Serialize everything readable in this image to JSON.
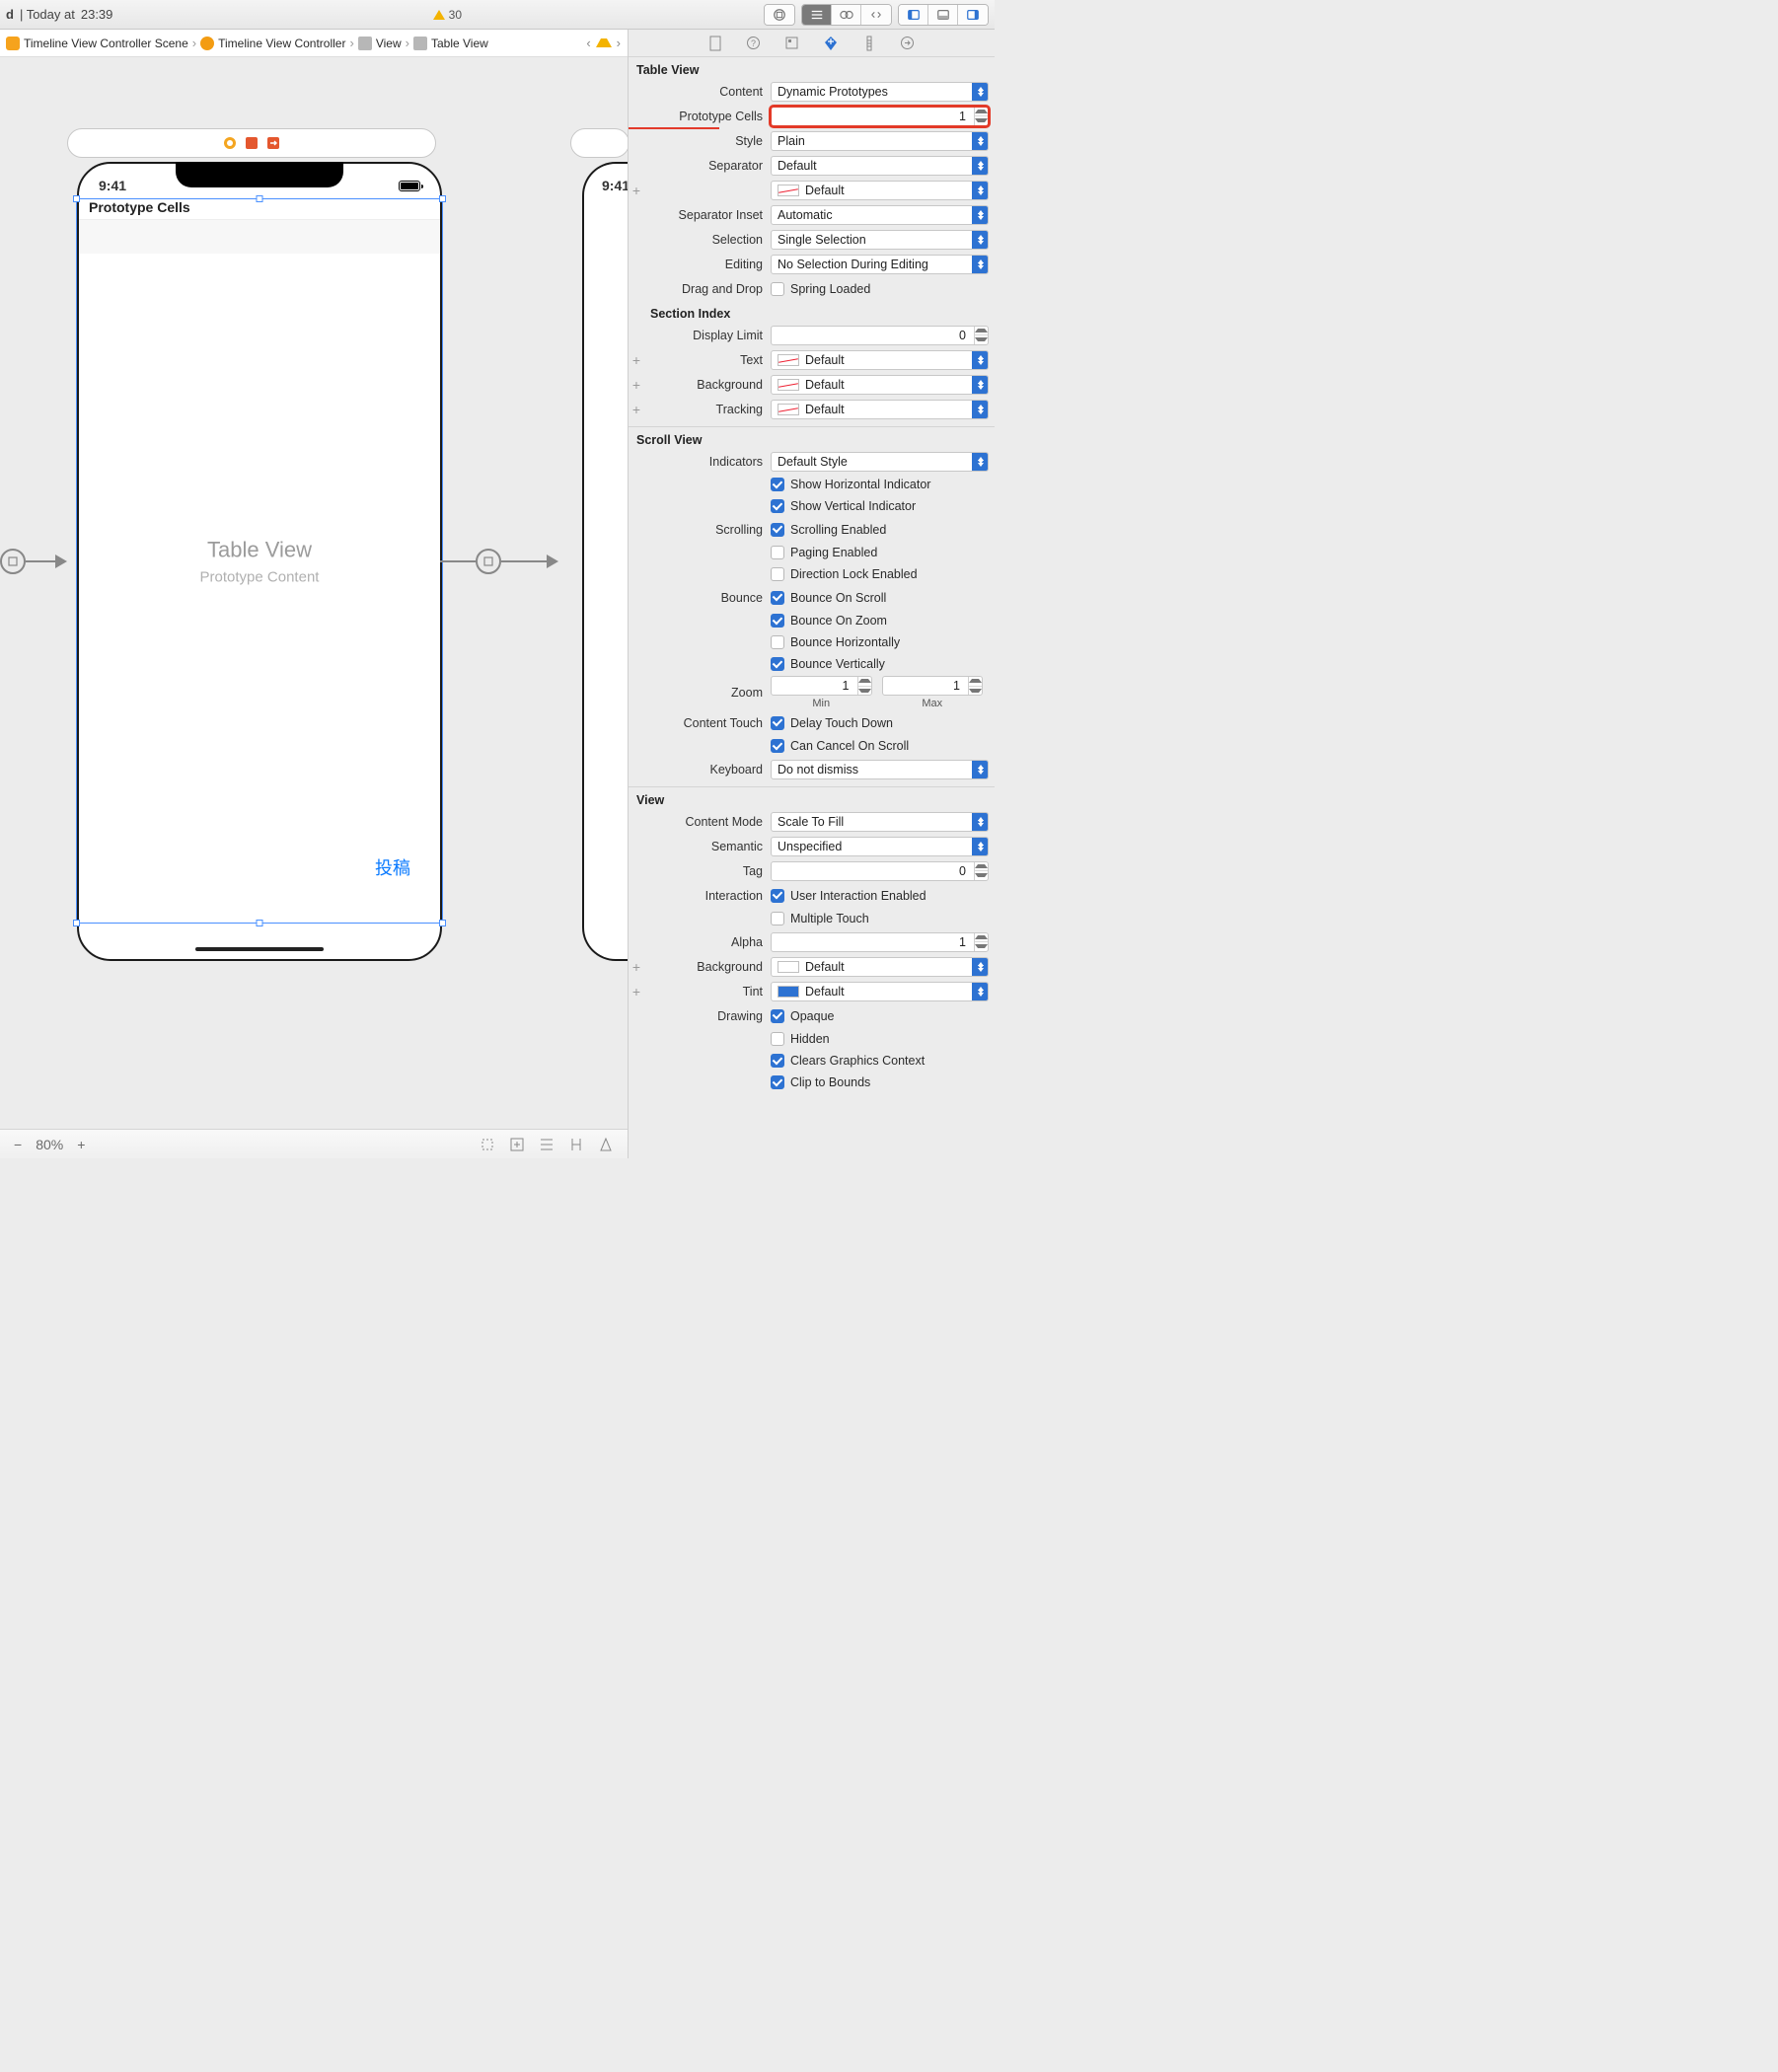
{
  "titlebar": {
    "prefix": "d",
    "time_prefix": "| Today at",
    "time": "23:39",
    "warning_count": "30"
  },
  "breadcrumb": {
    "items": [
      "Timeline View Controller Scene",
      "Timeline View Controller",
      "View",
      "Table View"
    ]
  },
  "canvas": {
    "capsule_icons": [
      "box",
      "cube",
      "export"
    ],
    "phone": {
      "time": "9:41",
      "cells_label": "Prototype Cells",
      "tableview_title": "Table View",
      "tableview_sub": "Prototype Content",
      "post_button": "投稿"
    },
    "phone2_time": "9:41",
    "zoom": "80%"
  },
  "inspector": {
    "tabs": [
      "file",
      "help",
      "identity",
      "attributes",
      "size",
      "connections"
    ],
    "table_view": {
      "title": "Table View",
      "content_label": "Content",
      "content": "Dynamic Prototypes",
      "prototype_cells_label": "Prototype Cells",
      "prototype_cells": "1",
      "style_label": "Style",
      "style": "Plain",
      "separator_label": "Separator",
      "separator": "Default",
      "separator_color": "Default",
      "separator_inset_label": "Separator Inset",
      "separator_inset": "Automatic",
      "selection_label": "Selection",
      "selection": "Single Selection",
      "editing_label": "Editing",
      "editing": "No Selection During Editing",
      "drag_drop_label": "Drag and Drop",
      "spring_loaded": "Spring Loaded",
      "section_index_title": "Section Index",
      "display_limit_label": "Display Limit",
      "display_limit": "0",
      "text_label": "Text",
      "text": "Default",
      "background_label": "Background",
      "background": "Default",
      "tracking_label": "Tracking",
      "tracking": "Default"
    },
    "scroll_view": {
      "title": "Scroll View",
      "indicators_label": "Indicators",
      "indicators": "Default Style",
      "show_h": "Show Horizontal Indicator",
      "show_v": "Show Vertical Indicator",
      "scrolling_label": "Scrolling",
      "scroll_enabled": "Scrolling Enabled",
      "paging": "Paging Enabled",
      "dirlock": "Direction Lock Enabled",
      "bounce_label": "Bounce",
      "bounce_scroll": "Bounce On Scroll",
      "bounce_zoom": "Bounce On Zoom",
      "bounce_h": "Bounce Horizontally",
      "bounce_v": "Bounce Vertically",
      "zoom_label": "Zoom",
      "zoom_min": "1",
      "zoom_max": "1",
      "min_label": "Min",
      "max_label": "Max",
      "content_touch_label": "Content Touch",
      "delay_touch": "Delay Touch Down",
      "cancel_scroll": "Can Cancel On Scroll",
      "keyboard_label": "Keyboard",
      "keyboard": "Do not dismiss"
    },
    "view": {
      "title": "View",
      "content_mode_label": "Content Mode",
      "content_mode": "Scale To Fill",
      "semantic_label": "Semantic",
      "semantic": "Unspecified",
      "tag_label": "Tag",
      "tag": "0",
      "interaction_label": "Interaction",
      "uie": "User Interaction Enabled",
      "multi": "Multiple Touch",
      "alpha_label": "Alpha",
      "alpha": "1",
      "background_label": "Background",
      "background": "Default",
      "tint_label": "Tint",
      "tint": "Default",
      "drawing_label": "Drawing",
      "opaque": "Opaque",
      "hidden": "Hidden",
      "clears_gc": "Clears Graphics Context",
      "clip": "Clip to Bounds"
    }
  }
}
